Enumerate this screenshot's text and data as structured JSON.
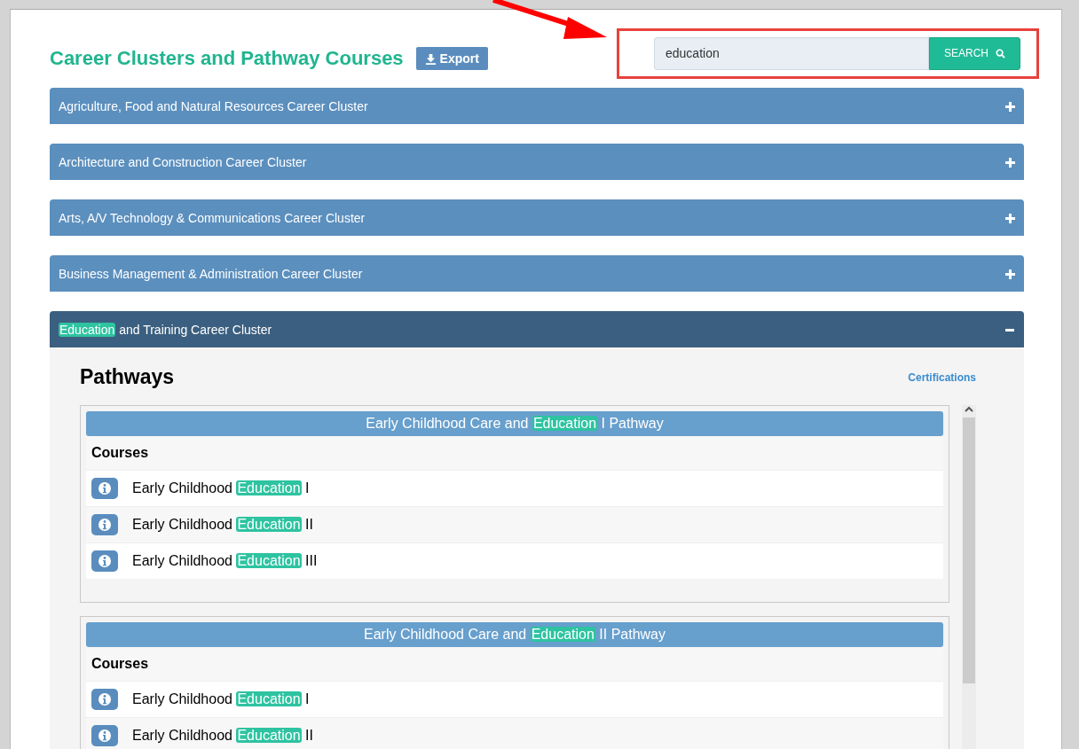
{
  "title": "Career Clusters and Pathway Courses",
  "export_button": "Export",
  "search": {
    "value": "education",
    "button": "SEARCH"
  },
  "clusters": [
    {
      "label": [
        {
          "text": "Agriculture, Food and Natural Resources Career Cluster",
          "highlighted": false
        }
      ],
      "expanded": false
    },
    {
      "label": [
        {
          "text": "Architecture and Construction Career Cluster",
          "highlighted": false
        }
      ],
      "expanded": false
    },
    {
      "label": [
        {
          "text": "Arts, A/V Technology & Communications Career Cluster",
          "highlighted": false
        }
      ],
      "expanded": false
    },
    {
      "label": [
        {
          "text": "Business Management & Administration Career Cluster",
          "highlighted": false
        }
      ],
      "expanded": false
    },
    {
      "label": [
        {
          "text": "Education",
          "highlighted": true
        },
        {
          "text": " and Training Career Cluster",
          "highlighted": false
        }
      ],
      "expanded": true,
      "pathways_heading": "Pathways",
      "certifications_link": "Certifications",
      "pathways": [
        {
          "title": [
            {
              "text": "Early Childhood Care and ",
              "highlighted": false
            },
            {
              "text": "Education",
              "highlighted": true
            },
            {
              "text": " I Pathway",
              "highlighted": false
            }
          ],
          "courses_heading": "Courses",
          "courses": [
            {
              "title": [
                {
                  "text": "Early Childhood ",
                  "highlighted": false
                },
                {
                  "text": "Education",
                  "highlighted": true
                },
                {
                  "text": " I",
                  "highlighted": false
                }
              ]
            },
            {
              "title": [
                {
                  "text": "Early Childhood ",
                  "highlighted": false
                },
                {
                  "text": "Education",
                  "highlighted": true
                },
                {
                  "text": " II",
                  "highlighted": false
                }
              ]
            },
            {
              "title": [
                {
                  "text": "Early Childhood ",
                  "highlighted": false
                },
                {
                  "text": "Education",
                  "highlighted": true
                },
                {
                  "text": " III",
                  "highlighted": false
                }
              ]
            }
          ]
        },
        {
          "title": [
            {
              "text": "Early Childhood Care and ",
              "highlighted": false
            },
            {
              "text": "Education",
              "highlighted": true
            },
            {
              "text": " II Pathway",
              "highlighted": false
            }
          ],
          "courses_heading": "Courses",
          "courses": [
            {
              "title": [
                {
                  "text": "Early Childhood ",
                  "highlighted": false
                },
                {
                  "text": "Education",
                  "highlighted": true
                },
                {
                  "text": " I",
                  "highlighted": false
                }
              ]
            },
            {
              "title": [
                {
                  "text": "Early Childhood ",
                  "highlighted": false
                },
                {
                  "text": "Education",
                  "highlighted": true
                },
                {
                  "text": " II",
                  "highlighted": false
                }
              ]
            }
          ]
        }
      ]
    }
  ]
}
